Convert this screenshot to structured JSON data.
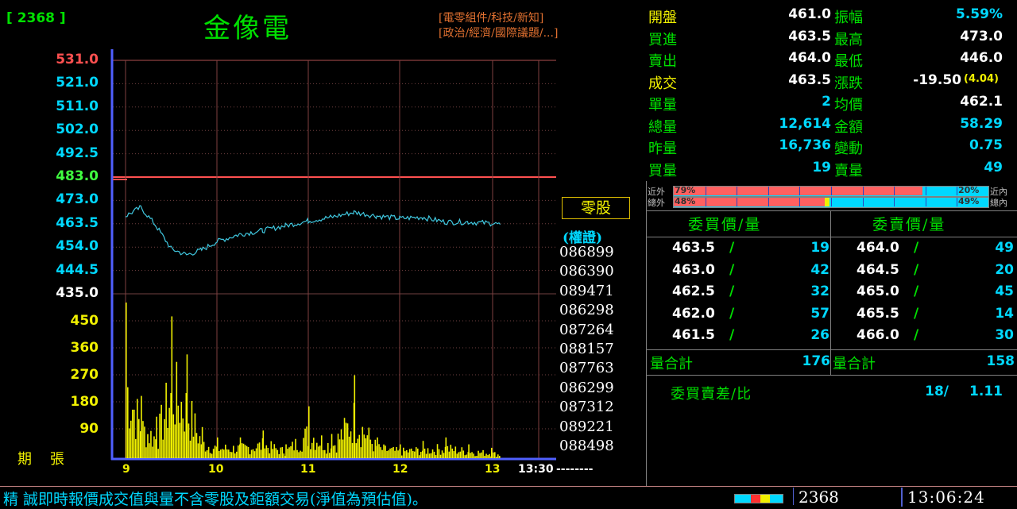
{
  "header": {
    "code_tag": "[ 2368 ]",
    "stock_name": "金像電",
    "tags": [
      "[電零組件/科技/新知]",
      "[政治/經濟/國際議題/...]"
    ]
  },
  "chart": {
    "price_ticks": [
      {
        "label": "531.0",
        "color": "#ff5050"
      },
      {
        "label": "521.0",
        "color": "#00d8ff"
      },
      {
        "label": "511.0",
        "color": "#00d8ff"
      },
      {
        "label": "502.0",
        "color": "#00d8ff"
      },
      {
        "label": "492.5",
        "color": "#00d8ff"
      },
      {
        "label": "483.0",
        "color": "#40ff40"
      },
      {
        "label": "473.0",
        "color": "#00d8ff"
      },
      {
        "label": "463.5",
        "color": "#00d8ff"
      },
      {
        "label": "454.0",
        "color": "#00d8ff"
      },
      {
        "label": "444.5",
        "color": "#00d8ff"
      },
      {
        "label": "435.0",
        "color": "#ffffff"
      }
    ],
    "volume_ticks": [
      "450",
      "360",
      "270",
      "180",
      "90"
    ],
    "volume_unit_label": "期    張",
    "time_labels": [
      "9",
      "10",
      "11",
      "12",
      "13",
      "13:30"
    ],
    "time_suffix": "--------"
  },
  "chart_data": {
    "type": "line",
    "title": "金像電",
    "x": [
      "09:00",
      "09:10",
      "09:20",
      "09:30",
      "09:40",
      "09:50",
      "10:00",
      "10:15",
      "10:30",
      "10:45",
      "11:00",
      "11:15",
      "11:30",
      "11:45",
      "12:00",
      "12:15",
      "12:30",
      "12:45",
      "13:00",
      "13:06"
    ],
    "series": [
      {
        "name": "price",
        "values": [
          467.0,
          470.5,
          463.0,
          453.5,
          451.0,
          453.0,
          456.5,
          459.5,
          461.0,
          463.0,
          465.0,
          466.5,
          468.5,
          467.0,
          466.0,
          466.5,
          464.5,
          464.5,
          464.0,
          463.5
        ]
      },
      {
        "name": "volume",
        "values": [
          450,
          180,
          120,
          410,
          300,
          90,
          60,
          60,
          80,
          40,
          150,
          70,
          240,
          60,
          40,
          50,
          60,
          40,
          30,
          20
        ]
      }
    ],
    "ylim": [
      435.0,
      531.0
    ],
    "reference_price": 483.0
  },
  "odd_lot": {
    "label": "零股",
    "warrant_label": "(權證)",
    "warrant_codes": [
      "086899",
      "086390",
      "089471",
      "086298",
      "087264",
      "088157",
      "087763",
      "086299",
      "087312",
      "089221",
      "088498"
    ]
  },
  "quote": {
    "rows": [
      {
        "l1": "開盤",
        "v1": "461.0",
        "l2": "振幅",
        "v2": "5.59%",
        "v2_color": "#00d8ff"
      },
      {
        "l1": "買進",
        "v1": "463.5",
        "l2": "最高",
        "v2": "473.0",
        "v2_color": "#ffffff"
      },
      {
        "l1": "賣出",
        "v1": "464.0",
        "l2": "最低",
        "v2": "446.0",
        "v2_color": "#ffffff"
      },
      {
        "l1": "成交",
        "v1": "463.5",
        "l2": "漲跌",
        "v2": "-19.50",
        "v2_color": "#ffffff"
      },
      {
        "l1": "單量",
        "v1": "2",
        "l2": "均價",
        "v2": "462.1",
        "v2_color": "#ffffff"
      },
      {
        "l1": "總量",
        "v1": "12,614",
        "l2": "金額",
        "v2": "58.29",
        "v2_color": "#00d8ff"
      },
      {
        "l1": "昨量",
        "v1": "16,736",
        "l2": "變動",
        "v2": "0.75",
        "v2_color": "#00d8ff"
      },
      {
        "l1": "買量",
        "v1": "19",
        "l2": "賣量",
        "v2": "49",
        "v2_color": "#00d8ff"
      }
    ],
    "change_pct": "(4.04)",
    "v1_colors": [
      "#ffffff",
      "#ffffff",
      "#ffffff",
      "#ffffff",
      "#00d8ff",
      "#00d8ff",
      "#00d8ff",
      "#00d8ff"
    ],
    "label_colors": [
      "#f0f000",
      "#00e000",
      "#00e000",
      "#f0f000",
      "#00e000",
      "#00e000",
      "#00e000",
      "#00e000"
    ]
  },
  "ratio_bars": {
    "near": {
      "left_label": "近外",
      "right_label": "近內",
      "left_pct": "79%",
      "right_pct": "20%",
      "left_value": 79
    },
    "total": {
      "left_label": "總外",
      "right_label": "總內",
      "left_pct": "48%",
      "right_pct": "49%",
      "left_value": 48
    }
  },
  "order_book": {
    "bid_header": "委買價/量",
    "ask_header": "委賣價/量",
    "bids": [
      {
        "price": "463.5",
        "qty": "19"
      },
      {
        "price": "463.0",
        "qty": "42"
      },
      {
        "price": "462.5",
        "qty": "32"
      },
      {
        "price": "462.0",
        "qty": "57"
      },
      {
        "price": "461.5",
        "qty": "26"
      }
    ],
    "asks": [
      {
        "price": "464.0",
        "qty": "49"
      },
      {
        "price": "464.5",
        "qty": "20"
      },
      {
        "price": "465.0",
        "qty": "45"
      },
      {
        "price": "465.5",
        "qty": "14"
      },
      {
        "price": "466.0",
        "qty": "30"
      }
    ],
    "bid_total_label": "量合計",
    "bid_total": "176",
    "ask_total_label": "量合計",
    "ask_total": "158",
    "spread_label": "委買賣差/比",
    "spread_value": "18/",
    "spread_ratio": "1.11"
  },
  "status_bar": {
    "ticker_text": "精 誠即時報價成交值與量不含零股及鉅額交易(淨值為預估值)。",
    "code": "2368",
    "time": "13:06:24"
  }
}
